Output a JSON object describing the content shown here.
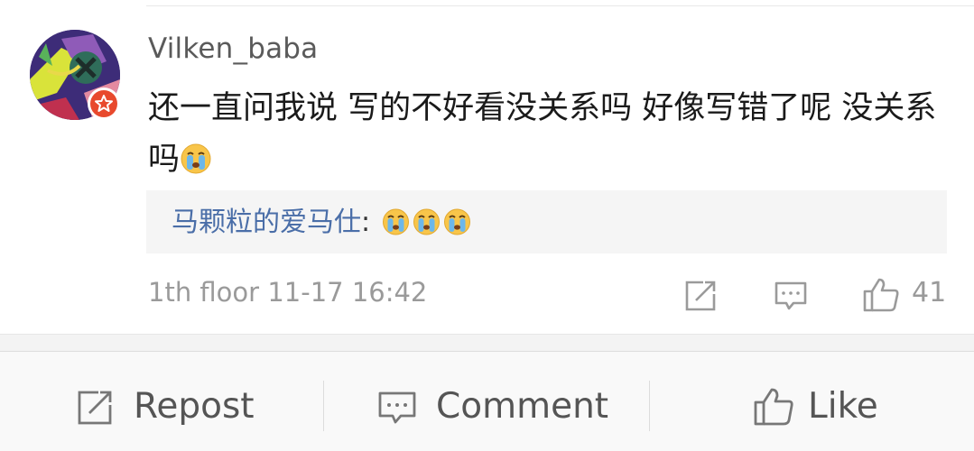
{
  "comment": {
    "username": "Vilken_baba",
    "text": "还一直问我说 写的不好看没关系吗 好像写错了呢 没关系吗",
    "trailing_emoji": "crying-face-emoji",
    "reply": {
      "author": "马颗粒的爱马仕",
      "separator": ":",
      "emojis": [
        "crying-face-emoji",
        "crying-face-emoji",
        "crying-face-emoji"
      ]
    },
    "floor": "1th floor",
    "timestamp": "11-17 16:42",
    "like_count": "41"
  },
  "bottom_bar": {
    "repost_label": "Repost",
    "comment_label": "Comment",
    "like_label": "Like"
  },
  "colors": {
    "reply_author": "#4a6ea8",
    "badge": "#e8492d",
    "text_primary": "#1a1a1a",
    "text_secondary": "#9a9a9a"
  }
}
